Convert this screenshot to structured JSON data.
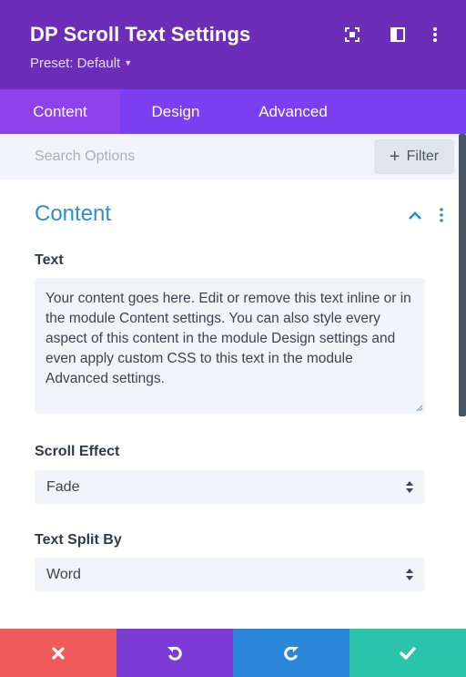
{
  "header": {
    "title": "DP Scroll Text Settings",
    "preset_label": "Preset: Default",
    "background_color": "#6c2eb9",
    "icons": [
      "focus-icon",
      "split-view-icon",
      "more-vertical-icon"
    ]
  },
  "tabs": [
    {
      "label": "Content",
      "active": true
    },
    {
      "label": "Design",
      "active": false
    },
    {
      "label": "Advanced",
      "active": false
    }
  ],
  "search": {
    "placeholder": "Search Options",
    "filter_label": "Filter"
  },
  "section": {
    "title": "Content",
    "accent_color": "#2e8ccf"
  },
  "fields": {
    "text": {
      "label": "Text",
      "value": "Your content goes here. Edit or remove this text inline or in the module Content settings. You can also style every aspect of this content in the module Design settings and even apply custom CSS to this text in the module Advanced settings."
    },
    "scroll_effect": {
      "label": "Scroll Effect",
      "value": "Fade"
    },
    "text_split_by": {
      "label": "Text Split By",
      "value": "Word"
    }
  },
  "footer": {
    "buttons": [
      {
        "name": "cancel",
        "icon": "close-icon",
        "color": "#ef5a5a"
      },
      {
        "name": "undo",
        "icon": "undo-icon",
        "color": "#7d3bd6"
      },
      {
        "name": "redo",
        "icon": "redo-icon",
        "color": "#2b87da"
      },
      {
        "name": "save",
        "icon": "check-icon",
        "color": "#29c4a9"
      }
    ]
  }
}
